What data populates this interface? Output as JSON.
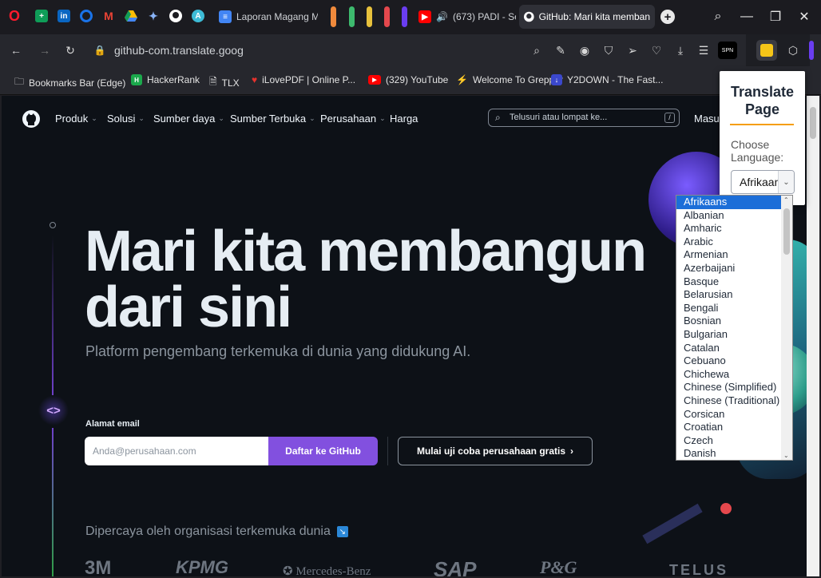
{
  "tabstrip": {
    "tabs": [
      {
        "label": "Laporan Magang M"
      },
      {
        "label": "(673) PADI - Se"
      },
      {
        "label": "GitHub: Mari kita memban"
      }
    ],
    "new_tab_symbol": "+"
  },
  "addressbar": {
    "url": "github-com.translate.goog"
  },
  "bookmarks": [
    {
      "label": "Bookmarks Bar (Edge)"
    },
    {
      "label": "HackerRank"
    },
    {
      "label": "TLX"
    },
    {
      "label": "iLovePDF | Online P..."
    },
    {
      "label": "(329) YouTube"
    },
    {
      "label": "Welcome To Grepper"
    },
    {
      "label": "Y2DOWN - The Fast..."
    }
  ],
  "github": {
    "nav": [
      "Produk",
      "Solusi",
      "Sumber daya",
      "Sumber Terbuka",
      "Perusahaan",
      "Harga"
    ],
    "search_placeholder": "Telusuri atau lompat ke...",
    "search_key": "/",
    "signin": "Masuk",
    "hero_line1": "Mari kita membangun",
    "hero_line2": "dari sini",
    "subtitle": "Platform pengembang terkemuka di dunia yang didukung AI.",
    "email_label": "Alamat email",
    "email_placeholder": "Anda@perusahaan.com",
    "signup_button": "Daftar ke GitHub",
    "trial_button": "Mulai uji coba perusahaan gratis",
    "trusted_text": "Dipercaya oleh organisasi terkemuka dunia",
    "logos": [
      "3M",
      "KPMG",
      "Mercedes-Benz",
      "SAP",
      "P&G",
      "TELUS"
    ]
  },
  "translate_popup": {
    "title_line1": "Translate",
    "title_line2": "Page",
    "choose_label_line1": "Choose",
    "choose_label_line2": "Language:",
    "selected_value": "Afrikaans",
    "accent_color": "#f59e0b",
    "options": [
      "Afrikaans",
      "Albanian",
      "Amharic",
      "Arabic",
      "Armenian",
      "Azerbaijani",
      "Basque",
      "Belarusian",
      "Bengali",
      "Bosnian",
      "Bulgarian",
      "Catalan",
      "Cebuano",
      "Chichewa",
      "Chinese (Simplified)",
      "Chinese (Traditional)",
      "Corsican",
      "Croatian",
      "Czech",
      "Danish"
    ]
  },
  "colors": {
    "github_purple": "#8250df",
    "selection_blue": "#1c6ed8"
  }
}
